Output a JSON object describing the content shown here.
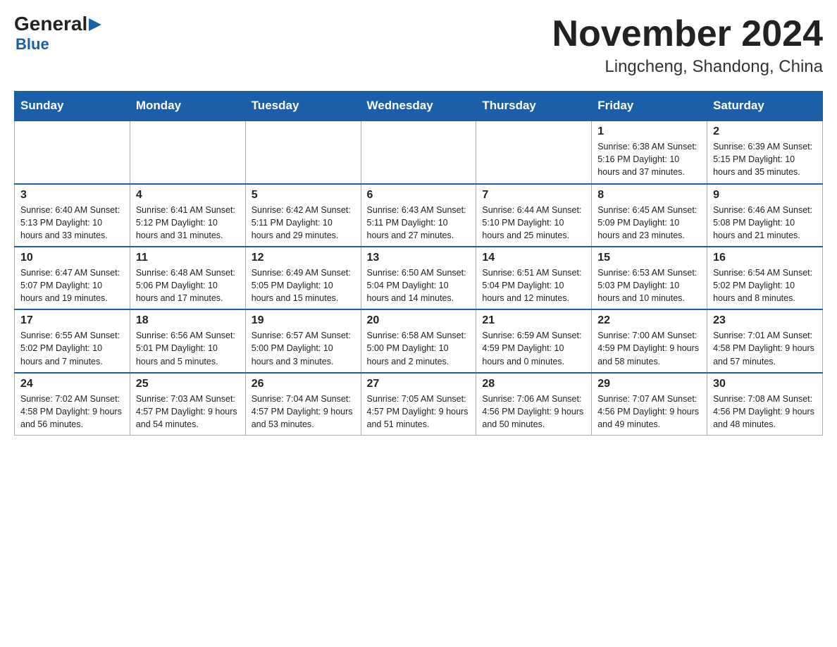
{
  "logo": {
    "general": "General",
    "blue": "Blue",
    "triangle": "▶"
  },
  "title": "November 2024",
  "subtitle": "Lingcheng, Shandong, China",
  "days_of_week": [
    "Sunday",
    "Monday",
    "Tuesday",
    "Wednesday",
    "Thursday",
    "Friday",
    "Saturday"
  ],
  "weeks": [
    [
      {
        "day": "",
        "info": "",
        "empty": true
      },
      {
        "day": "",
        "info": "",
        "empty": true
      },
      {
        "day": "",
        "info": "",
        "empty": true
      },
      {
        "day": "",
        "info": "",
        "empty": true
      },
      {
        "day": "",
        "info": "",
        "empty": true
      },
      {
        "day": "1",
        "info": "Sunrise: 6:38 AM\nSunset: 5:16 PM\nDaylight: 10 hours and 37 minutes.",
        "empty": false
      },
      {
        "day": "2",
        "info": "Sunrise: 6:39 AM\nSunset: 5:15 PM\nDaylight: 10 hours and 35 minutes.",
        "empty": false
      }
    ],
    [
      {
        "day": "3",
        "info": "Sunrise: 6:40 AM\nSunset: 5:13 PM\nDaylight: 10 hours and 33 minutes.",
        "empty": false
      },
      {
        "day": "4",
        "info": "Sunrise: 6:41 AM\nSunset: 5:12 PM\nDaylight: 10 hours and 31 minutes.",
        "empty": false
      },
      {
        "day": "5",
        "info": "Sunrise: 6:42 AM\nSunset: 5:11 PM\nDaylight: 10 hours and 29 minutes.",
        "empty": false
      },
      {
        "day": "6",
        "info": "Sunrise: 6:43 AM\nSunset: 5:11 PM\nDaylight: 10 hours and 27 minutes.",
        "empty": false
      },
      {
        "day": "7",
        "info": "Sunrise: 6:44 AM\nSunset: 5:10 PM\nDaylight: 10 hours and 25 minutes.",
        "empty": false
      },
      {
        "day": "8",
        "info": "Sunrise: 6:45 AM\nSunset: 5:09 PM\nDaylight: 10 hours and 23 minutes.",
        "empty": false
      },
      {
        "day": "9",
        "info": "Sunrise: 6:46 AM\nSunset: 5:08 PM\nDaylight: 10 hours and 21 minutes.",
        "empty": false
      }
    ],
    [
      {
        "day": "10",
        "info": "Sunrise: 6:47 AM\nSunset: 5:07 PM\nDaylight: 10 hours and 19 minutes.",
        "empty": false
      },
      {
        "day": "11",
        "info": "Sunrise: 6:48 AM\nSunset: 5:06 PM\nDaylight: 10 hours and 17 minutes.",
        "empty": false
      },
      {
        "day": "12",
        "info": "Sunrise: 6:49 AM\nSunset: 5:05 PM\nDaylight: 10 hours and 15 minutes.",
        "empty": false
      },
      {
        "day": "13",
        "info": "Sunrise: 6:50 AM\nSunset: 5:04 PM\nDaylight: 10 hours and 14 minutes.",
        "empty": false
      },
      {
        "day": "14",
        "info": "Sunrise: 6:51 AM\nSunset: 5:04 PM\nDaylight: 10 hours and 12 minutes.",
        "empty": false
      },
      {
        "day": "15",
        "info": "Sunrise: 6:53 AM\nSunset: 5:03 PM\nDaylight: 10 hours and 10 minutes.",
        "empty": false
      },
      {
        "day": "16",
        "info": "Sunrise: 6:54 AM\nSunset: 5:02 PM\nDaylight: 10 hours and 8 minutes.",
        "empty": false
      }
    ],
    [
      {
        "day": "17",
        "info": "Sunrise: 6:55 AM\nSunset: 5:02 PM\nDaylight: 10 hours and 7 minutes.",
        "empty": false
      },
      {
        "day": "18",
        "info": "Sunrise: 6:56 AM\nSunset: 5:01 PM\nDaylight: 10 hours and 5 minutes.",
        "empty": false
      },
      {
        "day": "19",
        "info": "Sunrise: 6:57 AM\nSunset: 5:00 PM\nDaylight: 10 hours and 3 minutes.",
        "empty": false
      },
      {
        "day": "20",
        "info": "Sunrise: 6:58 AM\nSunset: 5:00 PM\nDaylight: 10 hours and 2 minutes.",
        "empty": false
      },
      {
        "day": "21",
        "info": "Sunrise: 6:59 AM\nSunset: 4:59 PM\nDaylight: 10 hours and 0 minutes.",
        "empty": false
      },
      {
        "day": "22",
        "info": "Sunrise: 7:00 AM\nSunset: 4:59 PM\nDaylight: 9 hours and 58 minutes.",
        "empty": false
      },
      {
        "day": "23",
        "info": "Sunrise: 7:01 AM\nSunset: 4:58 PM\nDaylight: 9 hours and 57 minutes.",
        "empty": false
      }
    ],
    [
      {
        "day": "24",
        "info": "Sunrise: 7:02 AM\nSunset: 4:58 PM\nDaylight: 9 hours and 56 minutes.",
        "empty": false
      },
      {
        "day": "25",
        "info": "Sunrise: 7:03 AM\nSunset: 4:57 PM\nDaylight: 9 hours and 54 minutes.",
        "empty": false
      },
      {
        "day": "26",
        "info": "Sunrise: 7:04 AM\nSunset: 4:57 PM\nDaylight: 9 hours and 53 minutes.",
        "empty": false
      },
      {
        "day": "27",
        "info": "Sunrise: 7:05 AM\nSunset: 4:57 PM\nDaylight: 9 hours and 51 minutes.",
        "empty": false
      },
      {
        "day": "28",
        "info": "Sunrise: 7:06 AM\nSunset: 4:56 PM\nDaylight: 9 hours and 50 minutes.",
        "empty": false
      },
      {
        "day": "29",
        "info": "Sunrise: 7:07 AM\nSunset: 4:56 PM\nDaylight: 9 hours and 49 minutes.",
        "empty": false
      },
      {
        "day": "30",
        "info": "Sunrise: 7:08 AM\nSunset: 4:56 PM\nDaylight: 9 hours and 48 minutes.",
        "empty": false
      }
    ]
  ]
}
